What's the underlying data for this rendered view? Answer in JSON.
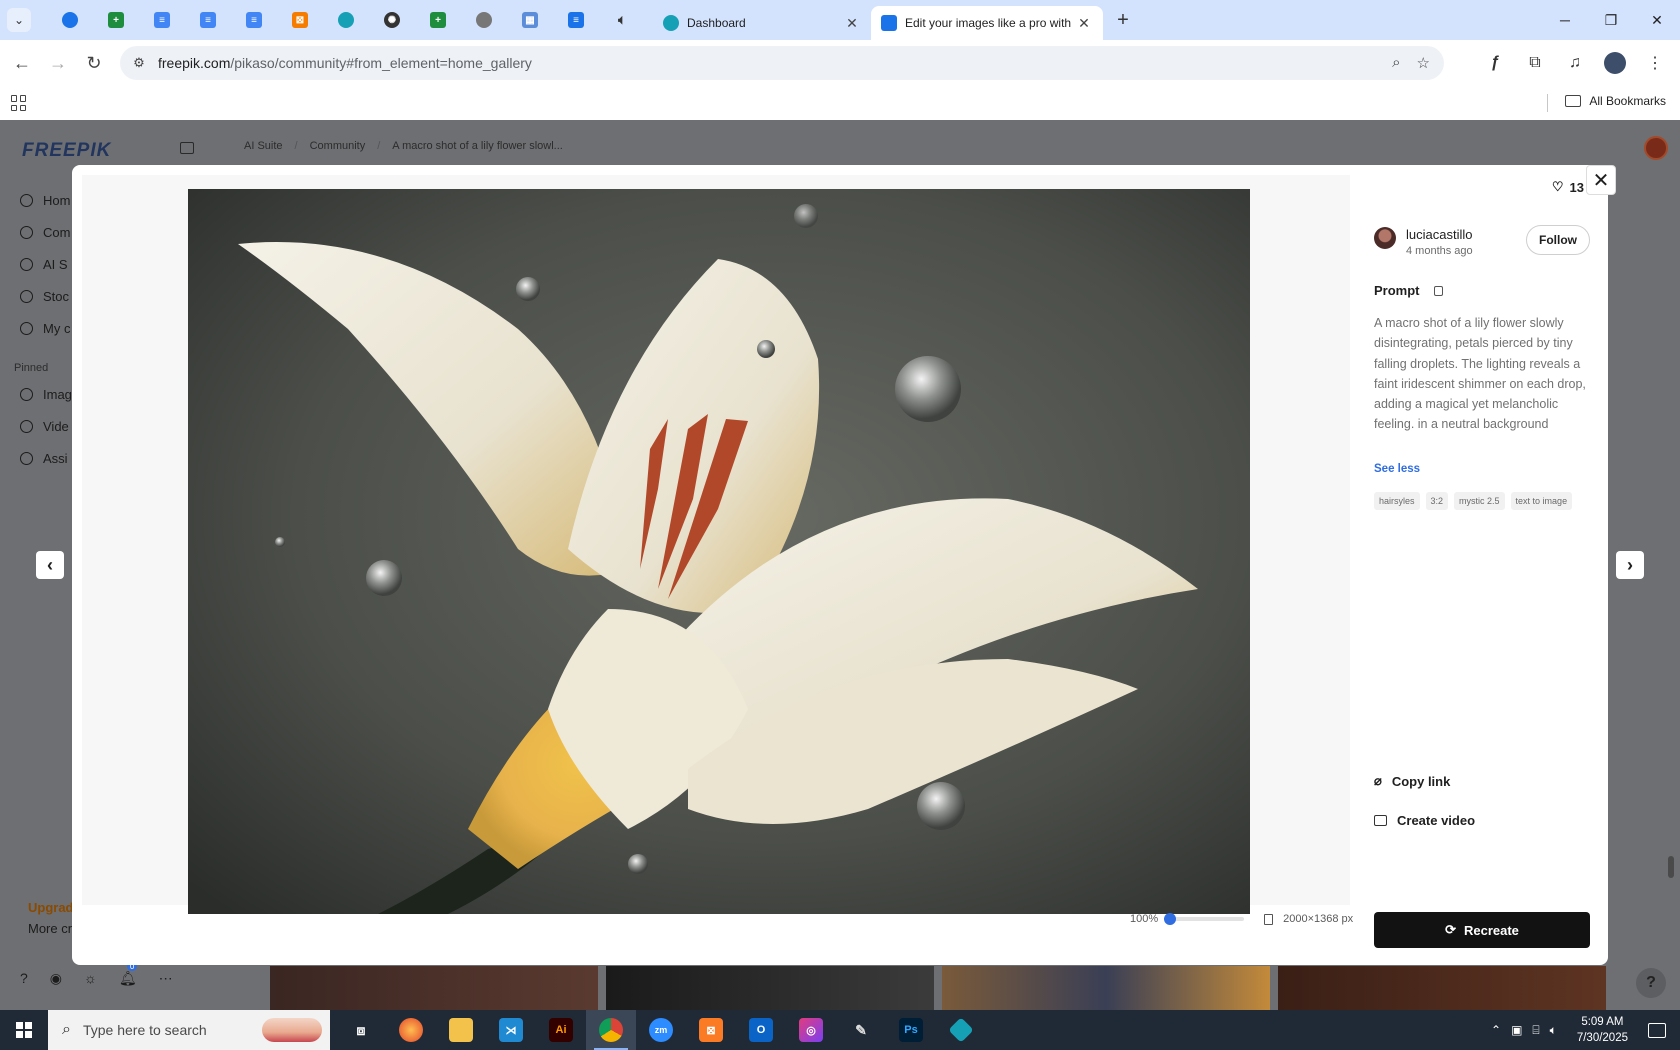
{
  "browser": {
    "tabs": [
      {
        "title": "Dashboard",
        "close": "✕"
      },
      {
        "title": "Edit your images like a pro with",
        "close": "✕"
      }
    ],
    "new_tab": "+",
    "url_host": "freepik.com",
    "url_path": "/pikaso/community#from_element=home_gallery",
    "bookmarks_label": "All Bookmarks",
    "window_controls": {
      "minimize": "─",
      "maximize": "❐",
      "close": "✕"
    }
  },
  "page": {
    "logo": "FREEPIK",
    "breadcrumb": [
      "AI Suite",
      "Community",
      "A macro shot of a lily flower slowl..."
    ],
    "sidebar": {
      "items": [
        "Hom",
        "Com",
        "AI S",
        "Stoc",
        "My c"
      ],
      "pinned_label": "Pinned",
      "pinned_items": [
        "Imag",
        "Vide",
        "Assi"
      ]
    },
    "upgrade": "Upgrad",
    "more": "More cr",
    "notif_count": "0"
  },
  "modal": {
    "likes": "13",
    "author": {
      "name": "luciacastillo",
      "time": "4 months ago"
    },
    "follow": "Follow",
    "prompt_label": "Prompt",
    "prompt_text": "A macro shot of a lily flower slowly disintegrating, petals pierced by tiny falling droplets. The lighting reveals a faint iridescent shimmer on each drop, adding a magical yet melancholic feeling. in a neutral background",
    "see_less": "See less",
    "tags": [
      "hairsyles",
      "3:2",
      "mystic 2.5",
      "text to image"
    ],
    "copy_link": "Copy link",
    "create_video": "Create video",
    "recreate": "Recreate",
    "zoom": "100%",
    "zoom_level": 0,
    "dimensions": "2000×1368 px"
  },
  "taskbar": {
    "search_placeholder": "Type here to search",
    "time": "5:09 AM",
    "date": "7/30/2025"
  },
  "colors": {
    "accent": "#2f6de1",
    "tabstrip": "#d3e3fd",
    "taskbar": "#202a36"
  }
}
